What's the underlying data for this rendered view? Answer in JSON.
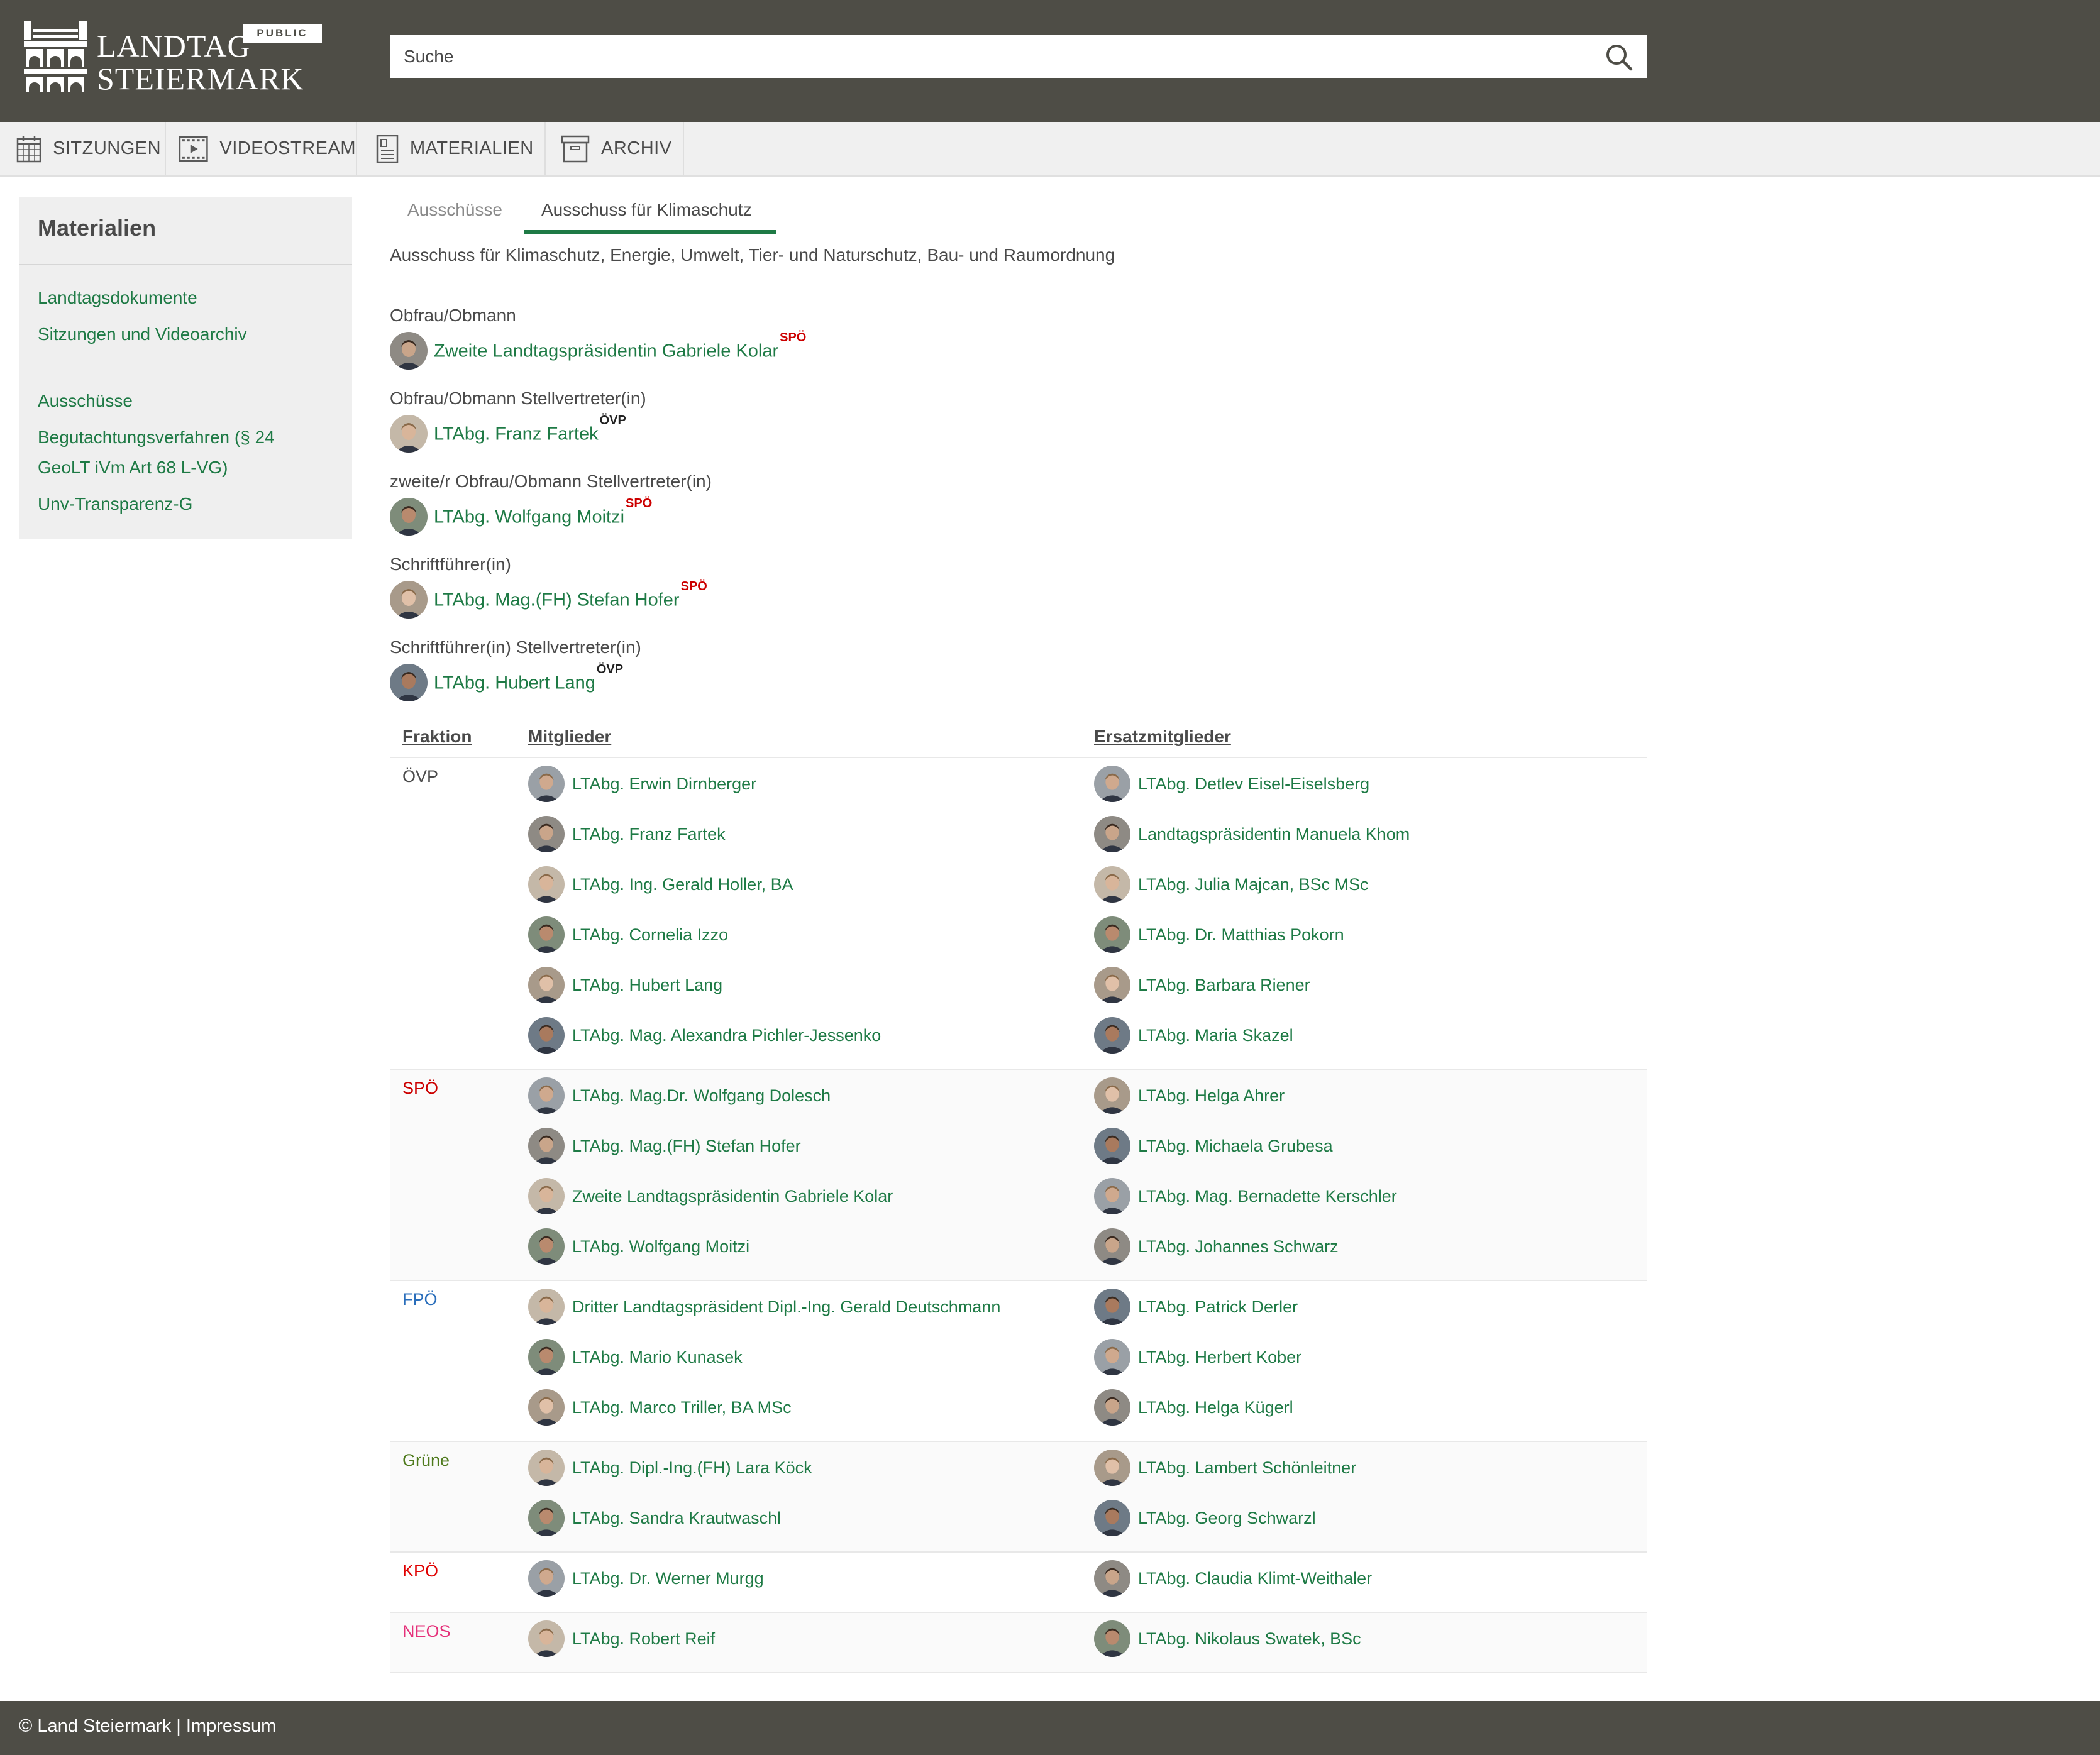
{
  "header": {
    "logo_line1": "LANDTAG",
    "logo_line2": "STEIERMARK",
    "badge": "PUBLIC",
    "search_placeholder": "Suche"
  },
  "nav": [
    {
      "label": "SITZUNGEN",
      "icon": "calendar-icon"
    },
    {
      "label": "VIDEOSTREAM",
      "icon": "film-icon"
    },
    {
      "label": "MATERIALIEN",
      "icon": "document-icon"
    },
    {
      "label": "ARCHIV",
      "icon": "archive-box-icon"
    }
  ],
  "sidebar": {
    "title": "Materialien",
    "links": [
      "Landtagsdokumente",
      "Sitzungen und Videoarchiv",
      "Ausschüsse",
      "Begutachtungsverfahren (§ 24",
      "GeoLT iVm Art 68 L-VG)",
      "Unv-Transparenz-G"
    ]
  },
  "tabs": [
    "Ausschüsse",
    "Ausschuss für Klimaschutz"
  ],
  "committee_full_name": "Ausschuss für Klimaschutz, Energie, Umwelt, Tier- und Naturschutz, Bau- und Raumordnung",
  "roles": [
    {
      "label": "Obfrau/Obmann",
      "name": "Zweite Landtagspräsidentin Gabriele Kolar",
      "party": "SPÖ"
    },
    {
      "label": "Obfrau/Obmann Stellvertreter(in)",
      "name": "LTAbg. Franz Fartek",
      "party": "ÖVP"
    },
    {
      "label": "zweite/r Obfrau/Obmann Stellvertreter(in)",
      "name": "LTAbg. Wolfgang Moitzi",
      "party": "SPÖ"
    },
    {
      "label": "Schriftführer(in)",
      "name": "LTAbg. Mag.(FH) Stefan Hofer",
      "party": "SPÖ"
    },
    {
      "label": "Schriftführer(in) Stellvertreter(in)",
      "name": "LTAbg. Hubert Lang",
      "party": "ÖVP"
    }
  ],
  "table": {
    "headers": [
      "Fraktion",
      "Mitglieder",
      "Ersatzmitglieder"
    ],
    "groups": [
      {
        "fraktion": "ÖVP",
        "color": "#4a4a4a",
        "members": [
          "LTAbg. Erwin Dirnberger",
          "LTAbg. Franz Fartek",
          "LTAbg. Ing. Gerald Holler, BA",
          "LTAbg. Cornelia Izzo",
          "LTAbg. Hubert Lang",
          "LTAbg. Mag. Alexandra Pichler-Jessenko"
        ],
        "substitutes": [
          "LTAbg. Detlev Eisel-Eiselsberg",
          "Landtagspräsidentin Manuela Khom",
          "LTAbg. Julia Majcan, BSc MSc",
          "LTAbg. Dr. Matthias Pokorn",
          "LTAbg. Barbara Riener",
          "LTAbg. Maria Skazel"
        ]
      },
      {
        "fraktion": "SPÖ",
        "color": "#cc0000",
        "members": [
          "LTAbg. Mag.Dr. Wolfgang Dolesch",
          "LTAbg. Mag.(FH) Stefan Hofer",
          "Zweite Landtagspräsidentin Gabriele Kolar",
          "LTAbg. Wolfgang Moitzi"
        ],
        "substitutes": [
          "LTAbg. Helga Ahrer",
          "LTAbg. Michaela Grubesa",
          "LTAbg. Mag. Bernadette Kerschler",
          "LTAbg. Johannes Schwarz"
        ]
      },
      {
        "fraktion": "FPÖ",
        "color": "#2a6ebb",
        "members": [
          "Dritter Landtagspräsident Dipl.-Ing. Gerald Deutschmann",
          "LTAbg. Mario Kunasek",
          "LTAbg. Marco Triller, BA MSc"
        ],
        "substitutes": [
          "LTAbg. Patrick Derler",
          "LTAbg. Herbert Kober",
          "LTAbg. Helga Kügerl"
        ]
      },
      {
        "fraktion": "Grüne",
        "color": "#4e7a1c",
        "members": [
          "LTAbg. Dipl.-Ing.(FH) Lara Köck",
          "LTAbg. Sandra Krautwaschl"
        ],
        "substitutes": [
          "LTAbg. Lambert Schönleitner",
          "LTAbg. Georg Schwarzl"
        ]
      },
      {
        "fraktion": "KPÖ",
        "color": "#e00000",
        "members": [
          "LTAbg. Dr. Werner Murgg"
        ],
        "substitutes": [
          "LTAbg. Claudia Klimt-Weithaler"
        ]
      },
      {
        "fraktion": "NEOS",
        "color": "#e5317a",
        "members": [
          "LTAbg. Robert Reif"
        ],
        "substitutes": [
          "LTAbg. Nikolaus Swatek, BSc"
        ]
      }
    ]
  },
  "footer": {
    "copyright": "© Land Steiermark",
    "separator": "|",
    "impressum": "Impressum"
  },
  "colors": {
    "header_bg": "#4e4d46",
    "link_green": "#1e7a45",
    "nav_bg": "#f0f0f0",
    "sidebar_bg": "#efefef"
  }
}
